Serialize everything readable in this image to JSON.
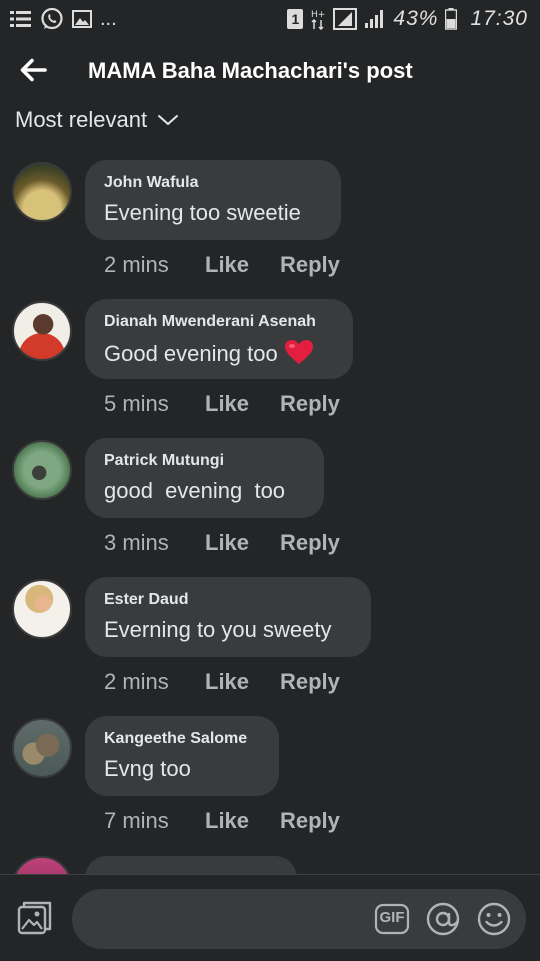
{
  "status_bar": {
    "icons": [
      "notification-list-icon",
      "whatsapp-icon",
      "gallery-icon",
      "more-dots-icon",
      "sim-1-icon",
      "data-hplus-icon",
      "wifi-signal-icon",
      "cell-signal-icon",
      "battery-icon"
    ],
    "dots": "...",
    "sim": "1",
    "battery_percent": "43%",
    "time": "17:30"
  },
  "header": {
    "back_icon": "back-arrow-icon",
    "title": "MAMA Baha Machachari's post"
  },
  "sort": {
    "label": "Most relevant",
    "icon": "chevron-down-icon"
  },
  "comments": [
    {
      "name": "John Wafula",
      "text": "Evening too sweetie",
      "time": "2 mins",
      "like": "Like",
      "reply": "Reply"
    },
    {
      "name": "Dianah Mwenderani Asenah",
      "text": "Good evening too",
      "emoji": "red-heart-icon",
      "time": "5 mins",
      "like": "Like",
      "reply": "Reply"
    },
    {
      "name": "Patrick Mutungi",
      "text": "good  evening  too",
      "time": "3 mins",
      "like": "Like",
      "reply": "Reply"
    },
    {
      "name": "Ester Daud",
      "text": "Everning to you sweety",
      "time": "2 mins",
      "like": "Like",
      "reply": "Reply"
    },
    {
      "name": "Kangeethe Salome",
      "text": "Evng too",
      "time": "7 mins",
      "like": "Like",
      "reply": "Reply"
    }
  ],
  "composer": {
    "photo_icon": "photo-icon",
    "input_value": "",
    "gif_label": "GIF",
    "mention_icon": "at-mention-icon",
    "emoji_icon": "smiley-icon"
  },
  "colors": {
    "background": "#242526",
    "bubble": "#3a3b3c",
    "text_primary": "#e4e6eb",
    "text_secondary": "#b0b3b8",
    "heart": "#e41e3f"
  }
}
